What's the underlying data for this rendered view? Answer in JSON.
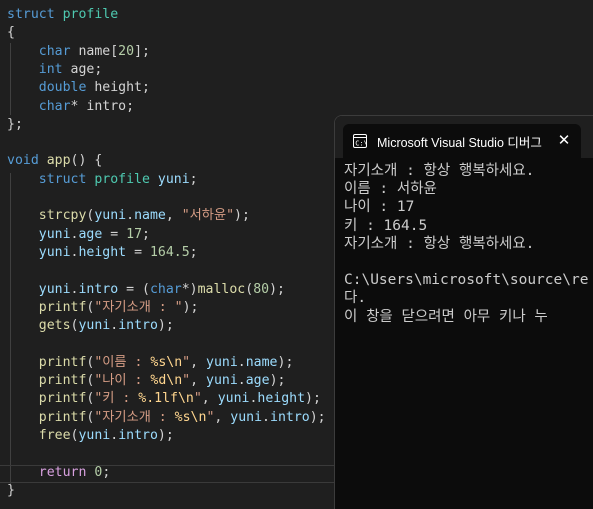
{
  "editor": {
    "lines": [
      [
        {
          "t": "struct",
          "c": "kw"
        },
        {
          "t": " ",
          "c": "pun"
        },
        {
          "t": "profile",
          "c": "ty"
        }
      ],
      [
        {
          "t": "{",
          "c": "pun"
        }
      ],
      [
        {
          "t": "    ",
          "c": "pun"
        },
        {
          "t": "char",
          "c": "kw"
        },
        {
          "t": " name[",
          "c": "pun"
        },
        {
          "t": "20",
          "c": "num"
        },
        {
          "t": "];",
          "c": "pun"
        }
      ],
      [
        {
          "t": "    ",
          "c": "pun"
        },
        {
          "t": "int",
          "c": "kw"
        },
        {
          "t": " age;",
          "c": "pun"
        }
      ],
      [
        {
          "t": "    ",
          "c": "pun"
        },
        {
          "t": "double",
          "c": "kw"
        },
        {
          "t": " height;",
          "c": "pun"
        }
      ],
      [
        {
          "t": "    ",
          "c": "pun"
        },
        {
          "t": "char",
          "c": "kw"
        },
        {
          "t": "* intro;",
          "c": "pun"
        }
      ],
      [
        {
          "t": "};",
          "c": "pun"
        }
      ],
      [],
      [
        {
          "t": "void",
          "c": "kw"
        },
        {
          "t": " ",
          "c": "pun"
        },
        {
          "t": "app",
          "c": "fn"
        },
        {
          "t": "() {",
          "c": "pun"
        }
      ],
      [
        {
          "t": "    ",
          "c": "pun"
        },
        {
          "t": "struct",
          "c": "kw"
        },
        {
          "t": " ",
          "c": "pun"
        },
        {
          "t": "profile",
          "c": "ty"
        },
        {
          "t": " ",
          "c": "pun"
        },
        {
          "t": "yuni",
          "c": "var"
        },
        {
          "t": ";",
          "c": "pun"
        }
      ],
      [],
      [
        {
          "t": "    ",
          "c": "pun"
        },
        {
          "t": "strcpy",
          "c": "fn"
        },
        {
          "t": "(",
          "c": "pun"
        },
        {
          "t": "yuni",
          "c": "var"
        },
        {
          "t": ".",
          "c": "pun"
        },
        {
          "t": "name",
          "c": "var"
        },
        {
          "t": ", ",
          "c": "pun"
        },
        {
          "t": "\"서하윤\"",
          "c": "str"
        },
        {
          "t": ");",
          "c": "pun"
        }
      ],
      [
        {
          "t": "    ",
          "c": "pun"
        },
        {
          "t": "yuni",
          "c": "var"
        },
        {
          "t": ".",
          "c": "pun"
        },
        {
          "t": "age",
          "c": "var"
        },
        {
          "t": " = ",
          "c": "pun"
        },
        {
          "t": "17",
          "c": "num"
        },
        {
          "t": ";",
          "c": "pun"
        }
      ],
      [
        {
          "t": "    ",
          "c": "pun"
        },
        {
          "t": "yuni",
          "c": "var"
        },
        {
          "t": ".",
          "c": "pun"
        },
        {
          "t": "height",
          "c": "var"
        },
        {
          "t": " = ",
          "c": "pun"
        },
        {
          "t": "164.5",
          "c": "num"
        },
        {
          "t": ";",
          "c": "pun"
        }
      ],
      [],
      [
        {
          "t": "    ",
          "c": "pun"
        },
        {
          "t": "yuni",
          "c": "var"
        },
        {
          "t": ".",
          "c": "pun"
        },
        {
          "t": "intro",
          "c": "var"
        },
        {
          "t": " = (",
          "c": "pun"
        },
        {
          "t": "char",
          "c": "kw"
        },
        {
          "t": "*)",
          "c": "pun"
        },
        {
          "t": "malloc",
          "c": "fn"
        },
        {
          "t": "(",
          "c": "pun"
        },
        {
          "t": "80",
          "c": "num"
        },
        {
          "t": ");",
          "c": "pun"
        }
      ],
      [
        {
          "t": "    ",
          "c": "pun"
        },
        {
          "t": "printf",
          "c": "fn"
        },
        {
          "t": "(",
          "c": "pun"
        },
        {
          "t": "\"자기소개 : \"",
          "c": "str"
        },
        {
          "t": ");",
          "c": "pun"
        }
      ],
      [
        {
          "t": "    ",
          "c": "pun"
        },
        {
          "t": "gets",
          "c": "fn"
        },
        {
          "t": "(",
          "c": "pun"
        },
        {
          "t": "yuni",
          "c": "var"
        },
        {
          "t": ".",
          "c": "pun"
        },
        {
          "t": "intro",
          "c": "var"
        },
        {
          "t": ");",
          "c": "pun"
        }
      ],
      [],
      [
        {
          "t": "    ",
          "c": "pun"
        },
        {
          "t": "printf",
          "c": "fn"
        },
        {
          "t": "(",
          "c": "pun"
        },
        {
          "t": "\"이름 : ",
          "c": "str"
        },
        {
          "t": "%s",
          "c": "esc"
        },
        {
          "t": "\\n",
          "c": "esc"
        },
        {
          "t": "\"",
          "c": "str"
        },
        {
          "t": ", ",
          "c": "pun"
        },
        {
          "t": "yuni",
          "c": "var"
        },
        {
          "t": ".",
          "c": "pun"
        },
        {
          "t": "name",
          "c": "var"
        },
        {
          "t": ");",
          "c": "pun"
        }
      ],
      [
        {
          "t": "    ",
          "c": "pun"
        },
        {
          "t": "printf",
          "c": "fn"
        },
        {
          "t": "(",
          "c": "pun"
        },
        {
          "t": "\"나이 : ",
          "c": "str"
        },
        {
          "t": "%d",
          "c": "esc"
        },
        {
          "t": "\\n",
          "c": "esc"
        },
        {
          "t": "\"",
          "c": "str"
        },
        {
          "t": ", ",
          "c": "pun"
        },
        {
          "t": "yuni",
          "c": "var"
        },
        {
          "t": ".",
          "c": "pun"
        },
        {
          "t": "age",
          "c": "var"
        },
        {
          "t": ");",
          "c": "pun"
        }
      ],
      [
        {
          "t": "    ",
          "c": "pun"
        },
        {
          "t": "printf",
          "c": "fn"
        },
        {
          "t": "(",
          "c": "pun"
        },
        {
          "t": "\"키 : ",
          "c": "str"
        },
        {
          "t": "%.1lf",
          "c": "esc"
        },
        {
          "t": "\\n",
          "c": "esc"
        },
        {
          "t": "\"",
          "c": "str"
        },
        {
          "t": ", ",
          "c": "pun"
        },
        {
          "t": "yuni",
          "c": "var"
        },
        {
          "t": ".",
          "c": "pun"
        },
        {
          "t": "height",
          "c": "var"
        },
        {
          "t": ");",
          "c": "pun"
        }
      ],
      [
        {
          "t": "    ",
          "c": "pun"
        },
        {
          "t": "printf",
          "c": "fn"
        },
        {
          "t": "(",
          "c": "pun"
        },
        {
          "t": "\"자기소개 : ",
          "c": "str"
        },
        {
          "t": "%s",
          "c": "esc"
        },
        {
          "t": "\\n",
          "c": "esc"
        },
        {
          "t": "\"",
          "c": "str"
        },
        {
          "t": ", ",
          "c": "pun"
        },
        {
          "t": "yuni",
          "c": "var"
        },
        {
          "t": ".",
          "c": "pun"
        },
        {
          "t": "intro",
          "c": "var"
        },
        {
          "t": ");",
          "c": "pun"
        }
      ],
      [
        {
          "t": "    ",
          "c": "pun"
        },
        {
          "t": "free",
          "c": "fn"
        },
        {
          "t": "(",
          "c": "pun"
        },
        {
          "t": "yuni",
          "c": "var"
        },
        {
          "t": ".",
          "c": "pun"
        },
        {
          "t": "intro",
          "c": "var"
        },
        {
          "t": ");",
          "c": "pun"
        }
      ],
      [],
      [
        {
          "t": "    ",
          "c": "pun"
        },
        {
          "t": "return",
          "c": "ctl"
        },
        {
          "t": " ",
          "c": "pun"
        },
        {
          "t": "0",
          "c": "num"
        },
        {
          "t": ";",
          "c": "pun"
        }
      ],
      [
        {
          "t": "}",
          "c": "pun"
        }
      ]
    ]
  },
  "console": {
    "tab_title": "Microsoft Visual Studio 디버그",
    "tab_icon": "console-app-icon",
    "close_icon": "close-icon",
    "lines": [
      "자기소개 : 항상 행복하세요.",
      "이름 : 서하윤",
      "나이 : 17",
      "키 : 164.5",
      "자기소개 : 항상 행복하세요.",
      "",
      "C:\\Users\\microsoft\\source\\re",
      "다.",
      "이 창을 닫으려면 아무 키나 누"
    ]
  },
  "colors": {
    "editor_bg": "#1f1f1f",
    "console_bg": "#0c0c0c",
    "keyword": "#569cd6",
    "type": "#4ec9b0",
    "function": "#dcdcaa",
    "variable": "#9cdcfe",
    "string": "#d69d85",
    "number": "#b5cea8"
  }
}
